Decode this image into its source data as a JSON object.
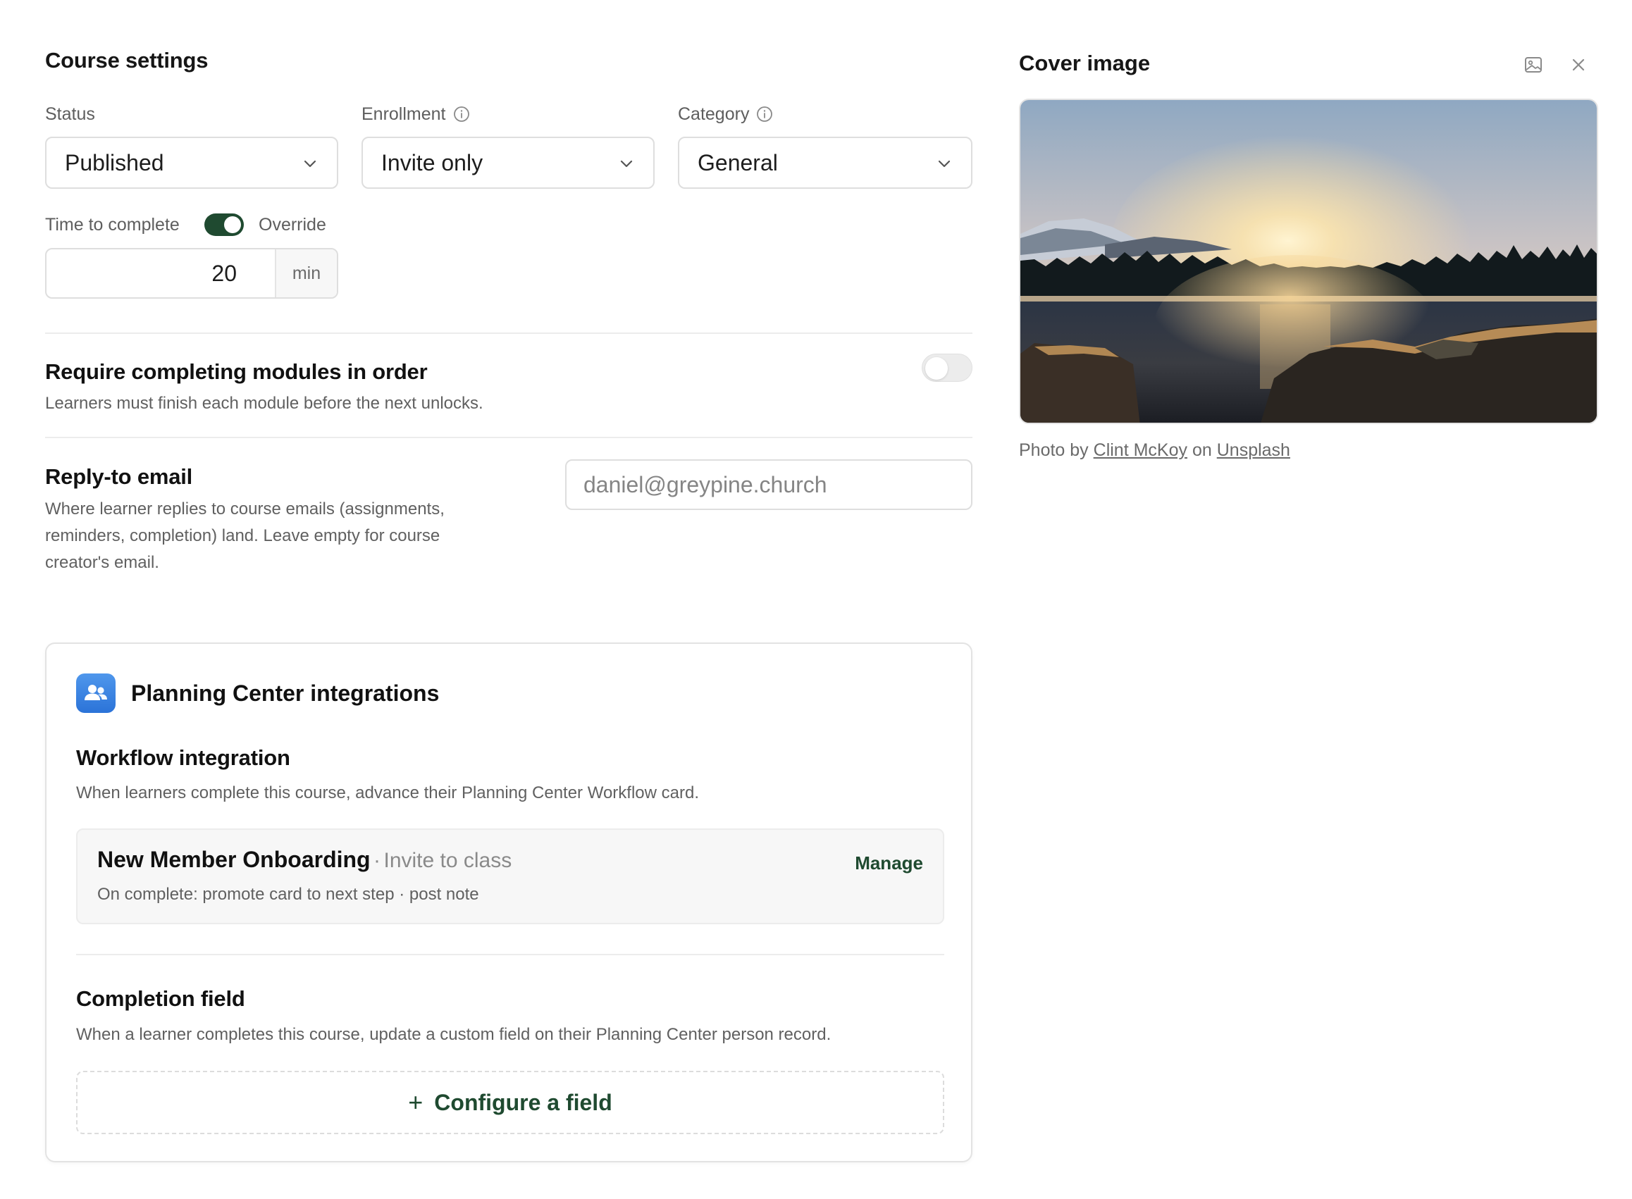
{
  "course_settings": {
    "title": "Course settings",
    "status": {
      "label": "Status",
      "value": "Published"
    },
    "enrollment": {
      "label": "Enrollment",
      "value": "Invite only"
    },
    "category": {
      "label": "Category",
      "value": "General"
    },
    "time_to_complete": {
      "label": "Time to complete",
      "override_label": "Override",
      "override_enabled": true,
      "value": "20",
      "unit": "min"
    }
  },
  "require_order": {
    "title": "Require completing modules in order",
    "description": "Learners must finish each module before the next unlocks.",
    "enabled": false
  },
  "reply_to": {
    "title": "Reply-to email",
    "description_line1": "Where learner replies to course emails (assignments,",
    "description_line2": "reminders, completion) land. Leave empty for course",
    "description_line3": "creator's email.",
    "placeholder": "daniel@greypine.church"
  },
  "integrations": {
    "title": "Planning Center integrations",
    "workflow": {
      "title": "Workflow integration",
      "description": "When learners complete this course, advance their Planning Center Workflow card.",
      "item_name": "New Member Onboarding",
      "separator": "·",
      "item_action": "Invite to class",
      "item_detail": "On complete: promote card to next step · post note",
      "manage_label": "Manage"
    },
    "completion": {
      "title": "Completion field",
      "description": "When a learner completes this course, update a custom field on their Planning Center person record.",
      "configure_label": "Configure a field",
      "configure_icon": "+"
    }
  },
  "cover": {
    "title": "Cover image",
    "credit_prefix": "Photo by",
    "credit_author": "Clint McKoy",
    "credit_mid": "on",
    "credit_source": "Unsplash"
  },
  "icons": {
    "chevron": "chevron-down-icon",
    "info": "info-icon",
    "image": "image-icon",
    "close": "close-icon",
    "people": "people-icon"
  },
  "colors": {
    "accent": "#1f4a30",
    "pc_blue": "#2b73d8"
  }
}
